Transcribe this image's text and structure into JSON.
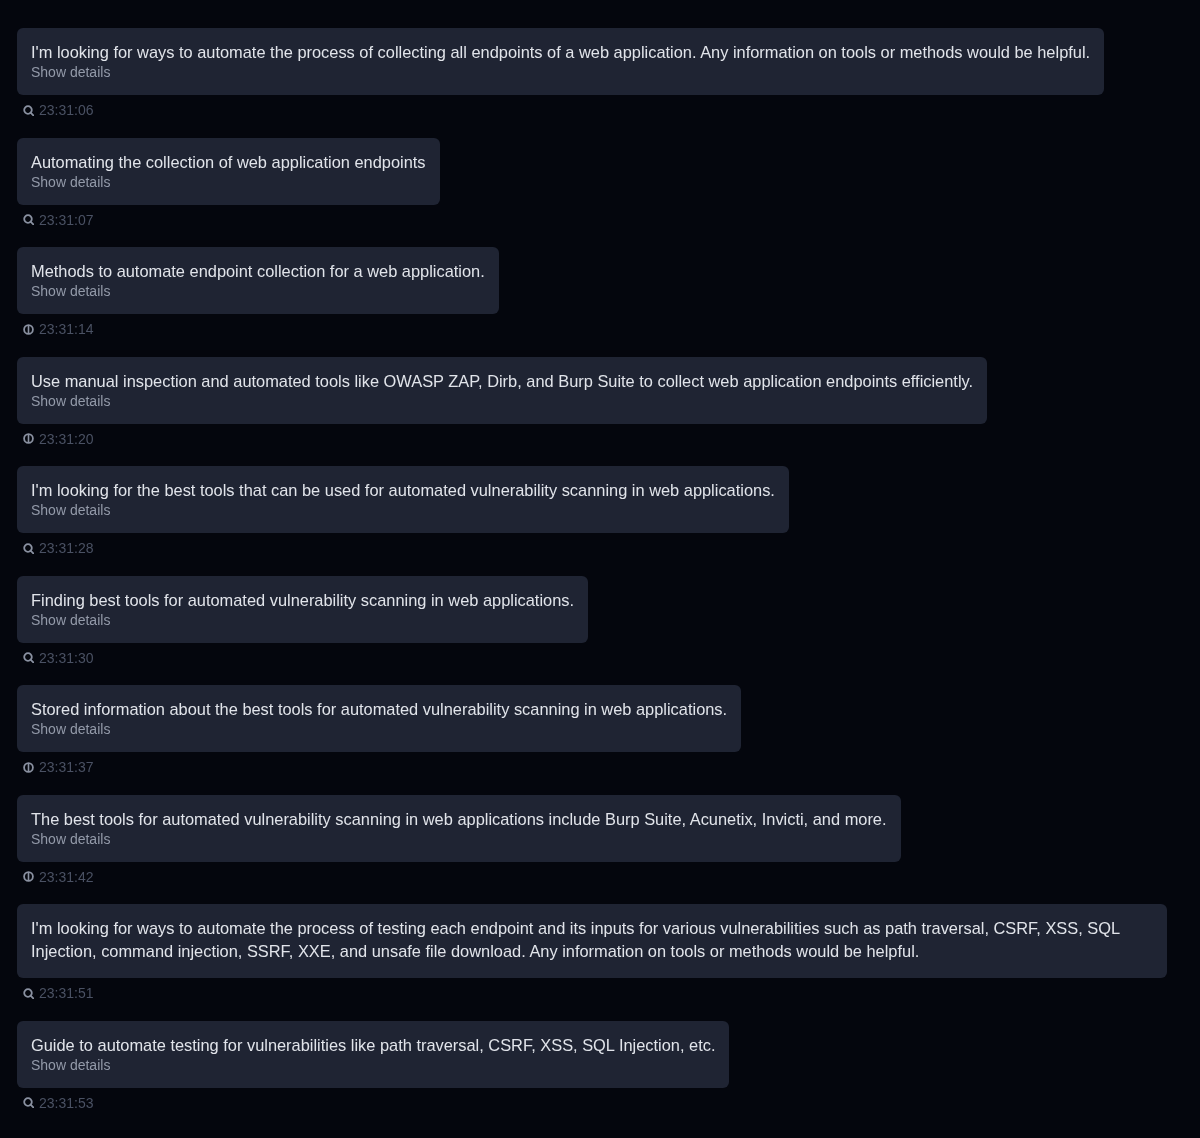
{
  "messages": [
    {
      "text": "I'm looking for ways to automate the process of collecting all endpoints of a web application. Any information on tools or methods would be helpful.",
      "details": "Show details",
      "kind": "search",
      "time": "23:31:06"
    },
    {
      "text": "Automating the collection of web application endpoints",
      "details": "Show details",
      "kind": "search",
      "time": "23:31:07"
    },
    {
      "text": "Methods to automate endpoint collection for a web application.",
      "details": "Show details",
      "kind": "memory",
      "time": "23:31:14"
    },
    {
      "text": "Use manual inspection and automated tools like OWASP ZAP, Dirb, and Burp Suite to collect web application endpoints efficiently.",
      "details": "Show details",
      "kind": "memory",
      "time": "23:31:20"
    },
    {
      "text": "I'm looking for the best tools that can be used for automated vulnerability scanning in web applications.",
      "details": "Show details",
      "kind": "search",
      "time": "23:31:28"
    },
    {
      "text": "Finding best tools for automated vulnerability scanning in web applications.",
      "details": "Show details",
      "kind": "search",
      "time": "23:31:30"
    },
    {
      "text": "Stored information about the best tools for automated vulnerability scanning in web applications.",
      "details": "Show details",
      "kind": "memory",
      "time": "23:31:37"
    },
    {
      "text": "The best tools for automated vulnerability scanning in web applications include Burp Suite, Acunetix, Invicti, and more.",
      "details": "Show details",
      "kind": "memory",
      "time": "23:31:42"
    },
    {
      "text": "I'm looking for ways to automate the process of testing each endpoint and its inputs for various vulnerabilities such as path traversal, CSRF, XSS, SQL Injection, command injection, SSRF, XXE, and unsafe file download. Any information on tools or methods would be helpful.",
      "kind": "search",
      "time": "23:31:51"
    },
    {
      "text": "Guide to automate testing for vulnerabilities like path traversal, CSRF, XSS, SQL Injection, etc.",
      "details": "Show details",
      "kind": "search",
      "time": "23:31:53"
    }
  ]
}
